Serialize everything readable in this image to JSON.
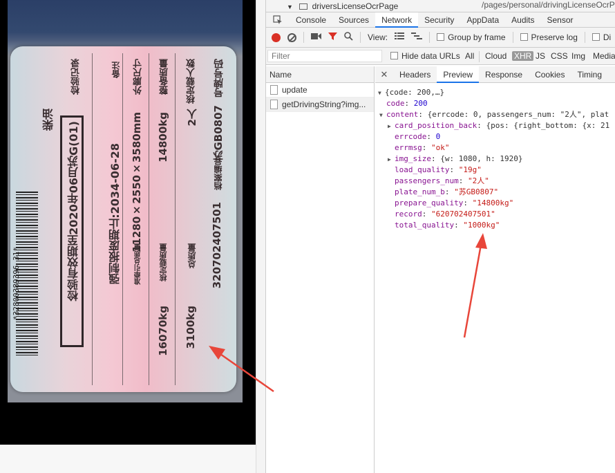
{
  "photo": {
    "card_texts": [
      "号牌号码",
      "苏GB0807",
      "档案编号",
      "320702407501",
      "核定载人数",
      "2人",
      "总质量",
      "3100kg",
      "整备质量",
      "14800kg",
      "核定载质量",
      "16070kg",
      "外廓尺寸",
      "11280×2550×3580mm",
      "准牵引总质量",
      "备注",
      "强制报废期止:2034-06-28",
      "检验记录",
      "检验有效期至2020年06月苏G(01)",
      "柴油"
    ],
    "barcode_digits": "*32800389396 31*"
  },
  "devtools": {
    "top_node": "driversLicenseOcrPage",
    "top_path": "/pages/personal/drivingLicenseOcrP",
    "tabs": [
      "Console",
      "Sources",
      "Network",
      "Security",
      "AppData",
      "Audits",
      "Sensor"
    ],
    "active_tab": "Network",
    "toolbar": {
      "view_label": "View:",
      "group_by_frame": "Group by frame",
      "preserve_log": "Preserve log",
      "disable": "Di"
    },
    "filter": {
      "placeholder": "Filter",
      "hide_data_urls": "Hide data URLs",
      "types": [
        "All",
        "Cloud",
        "XHR",
        "JS",
        "CSS",
        "Img",
        "Media"
      ],
      "active_type": "XHR"
    },
    "name_header": "Name",
    "requests": [
      "update",
      "getDrivingString?img..."
    ],
    "selected_request": "getDrivingString?img...",
    "detail_tabs": [
      "Headers",
      "Preview",
      "Response",
      "Cookies",
      "Timing"
    ],
    "active_detail_tab": "Preview",
    "json": {
      "summary": "{code: 200,…}",
      "code_key": "code",
      "code_val": "200",
      "content_key": "content",
      "content_summary": "{errcode: 0, passengers_num: \"2人\", plat",
      "card_position_back_key": "card_position_back",
      "card_position_back_val": "{pos: {right_bottom: {x: 21",
      "errcode_key": "errcode",
      "errcode_val": "0",
      "errmsg_key": "errmsg",
      "errmsg_val": "\"ok\"",
      "img_size_key": "img_size",
      "img_size_val": "{w: 1080, h: 1920}",
      "load_quality_key": "load_quality",
      "load_quality_val": "\"19g\"",
      "passengers_num_key": "passengers_num",
      "passengers_num_val": "\"2人\"",
      "plate_num_b_key": "plate_num_b",
      "plate_num_b_val": "\"苏GB0807\"",
      "prepare_quality_key": "prepare_quality",
      "prepare_quality_val": "\"14800kg\"",
      "record_key": "record",
      "record_val": "\"620702407501\"",
      "total_quality_key": "total_quality",
      "total_quality_val": "\"1000kg\""
    }
  },
  "colors": {
    "annotation_arrow": "#e8463a",
    "active_tab_underline": "#1a73e8",
    "record_button": "#d93025"
  }
}
